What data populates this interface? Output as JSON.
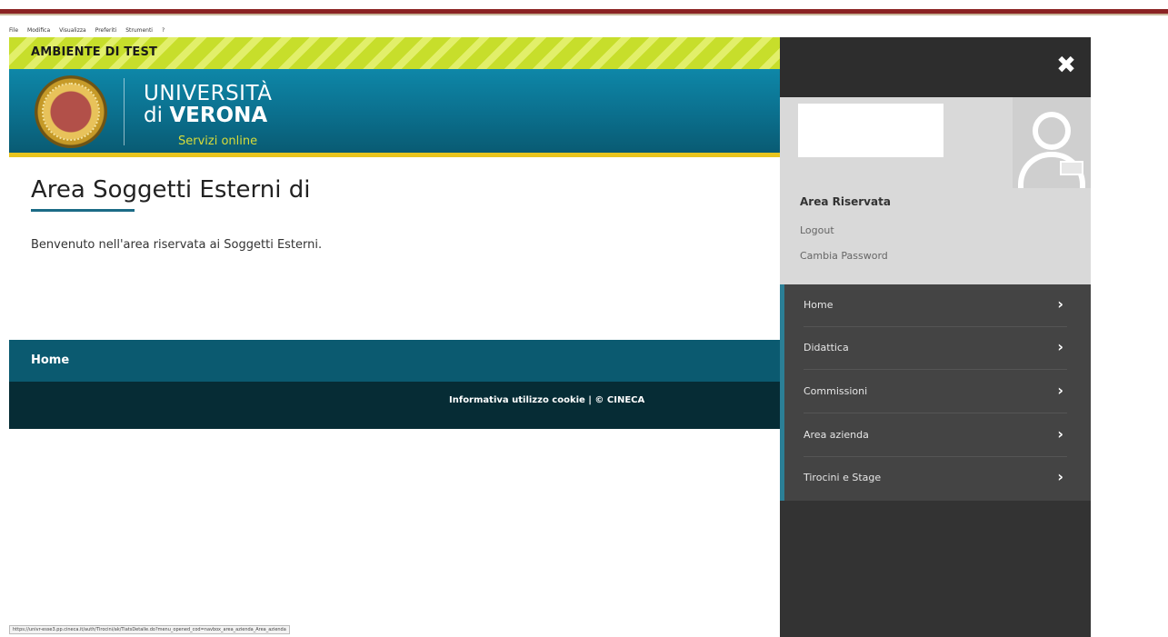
{
  "browser_menu": [
    "File",
    "Modifica",
    "Visualizza",
    "Preferiti",
    "Strumenti",
    "?"
  ],
  "env_banner": "AMBIENTE DI TEST",
  "brand": {
    "line1": "UNIVERSITÀ",
    "line2_prefix": "di",
    "line2_bold": "VERONA",
    "tagline": "Servizi online"
  },
  "page": {
    "title": "Area Soggetti Esterni di",
    "welcome": "Benvenuto nell'area riservata ai Soggetti Esterni."
  },
  "nav": {
    "home": "Home"
  },
  "footer": {
    "links": "Informativa utilizzo cookie | © CINECA"
  },
  "status_url": "https://univr-esse3.pp.cineca.it/auth/Tirocini/ak/TiatsDetalle.do?menu_opened_cod=navbox_area_azienda_Area_azienda",
  "drawer": {
    "close": "✖",
    "area_title": "Area Riservata",
    "logout": "Logout",
    "change_password": "Cambia Password",
    "menu": [
      {
        "label": "Home",
        "chevron": "›"
      },
      {
        "label": "Didattica",
        "chevron": "›"
      },
      {
        "label": "Commissioni",
        "chevron": "›"
      },
      {
        "label": "Area azienda",
        "chevron": "›"
      },
      {
        "label": "Tirocini e Stage",
        "chevron": "›"
      }
    ]
  },
  "colors": {
    "env_banner": "#c7de2b",
    "brand_blue": "#0b6f8d",
    "accent_yellow": "#e8c41e",
    "nav_strip": "#0b5a70",
    "footer": "#062c35",
    "drawer": "#333333",
    "menu": "#444444",
    "top_rule": "#8b2323"
  },
  "icons": [
    "university-seal-logo",
    "close-icon",
    "user-avatar-icon",
    "chevron-right-icon"
  ]
}
